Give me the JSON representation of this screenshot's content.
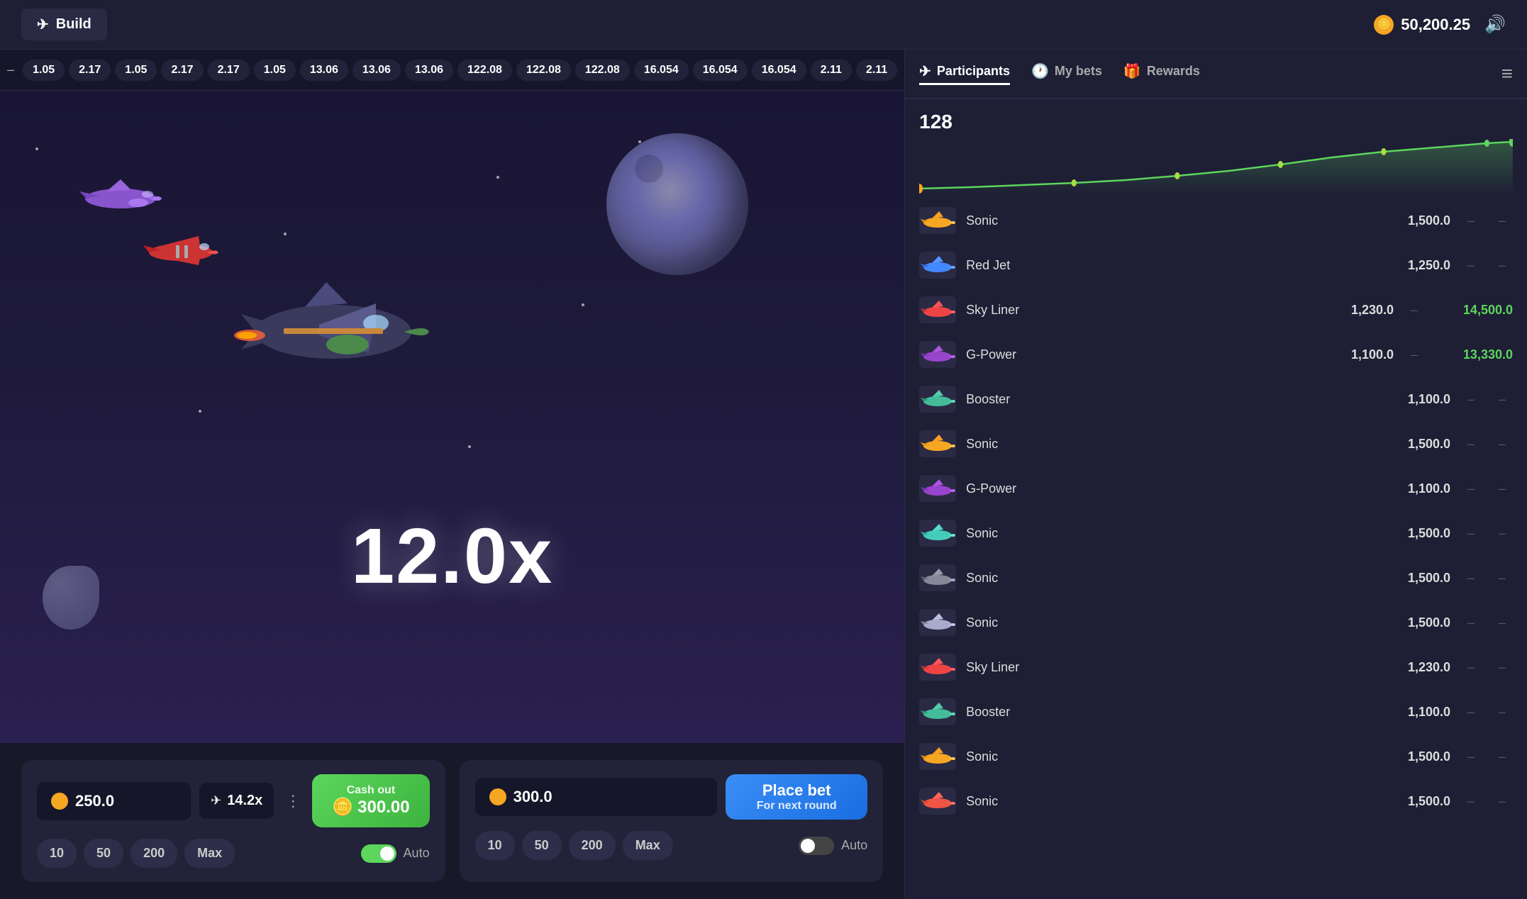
{
  "header": {
    "build_label": "Build",
    "balance": "50,200.25",
    "volume_icon": "🔊"
  },
  "ticker": {
    "items": [
      "1.05",
      "2.17",
      "1.05",
      "2.17",
      "2.17",
      "1.05",
      "13.06",
      "13.06",
      "13.06",
      "122.08",
      "122.08",
      "122.08",
      "16.054",
      "16.054",
      "16.054",
      "2.11",
      "2.11"
    ]
  },
  "game": {
    "multiplier": "12.0x"
  },
  "bet_panel_1": {
    "amount": "250.0",
    "multiplier": "14.2x",
    "cashout_label": "Cash out",
    "cashout_amount": "300.00",
    "quick_bets": [
      "10",
      "50",
      "200",
      "Max"
    ],
    "auto_label": "Auto",
    "auto_on": true
  },
  "bet_panel_2": {
    "amount": "300.0",
    "place_bet_label": "Place bet",
    "place_bet_sub": "For next round",
    "quick_bets": [
      "10",
      "50",
      "200",
      "Max"
    ],
    "auto_label": "Auto",
    "auto_on": false
  },
  "right_panel": {
    "tabs": [
      {
        "label": "Participants",
        "active": true
      },
      {
        "label": "My bets",
        "active": false
      },
      {
        "label": "Rewards",
        "active": false
      }
    ],
    "graph_count": "128",
    "participants": [
      {
        "name": "Sonic",
        "bet": "1,500.0",
        "win": ""
      },
      {
        "name": "Red Jet",
        "bet": "1,250.0",
        "win": ""
      },
      {
        "name": "Sky Liner",
        "bet": "1,230.0",
        "win": "14,500.0"
      },
      {
        "name": "G-Power",
        "bet": "1,100.0",
        "win": "13,330.0"
      },
      {
        "name": "Booster",
        "bet": "1,100.0",
        "win": ""
      },
      {
        "name": "Sonic",
        "bet": "1,500.0",
        "win": ""
      },
      {
        "name": "G-Power",
        "bet": "1,100.0",
        "win": ""
      },
      {
        "name": "Sonic",
        "bet": "1,500.0",
        "win": ""
      },
      {
        "name": "Sonic",
        "bet": "1,500.0",
        "win": ""
      },
      {
        "name": "Sonic",
        "bet": "1,500.0",
        "win": ""
      },
      {
        "name": "Sky Liner",
        "bet": "1,230.0",
        "win": ""
      },
      {
        "name": "Booster",
        "bet": "1,100.0",
        "win": ""
      },
      {
        "name": "Sonic",
        "bet": "1,500.0",
        "win": ""
      },
      {
        "name": "Sonic",
        "bet": "1,500.0",
        "win": ""
      }
    ]
  }
}
